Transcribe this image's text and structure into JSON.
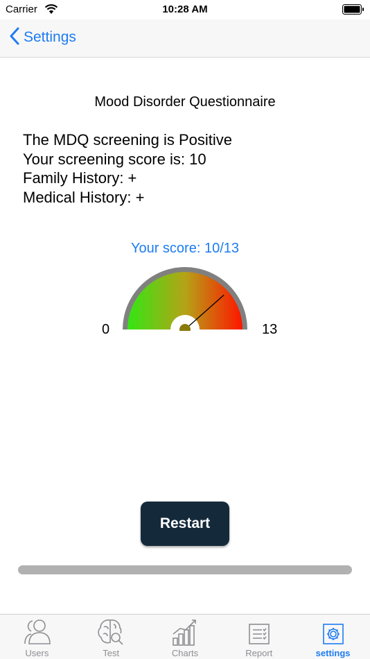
{
  "status_bar": {
    "carrier": "Carrier",
    "time": "10:28 AM"
  },
  "nav": {
    "back_label": "Settings"
  },
  "main": {
    "title": "Mood Disorder Questionnaire",
    "results": [
      "The MDQ screening is Positive",
      "Your screening score is: 10",
      "Family History: +",
      "Medical History: +"
    ],
    "score_label": "Your score: 10/13",
    "gauge": {
      "min_label": "0",
      "max_label": "13",
      "value": 10,
      "max": 13
    },
    "restart_label": "Restart"
  },
  "tabs": [
    {
      "label": "Users",
      "icon": "users-icon",
      "active": false
    },
    {
      "label": "Test",
      "icon": "brain-search-icon",
      "active": false
    },
    {
      "label": "Charts",
      "icon": "bar-chart-icon",
      "active": false
    },
    {
      "label": "Report",
      "icon": "report-icon",
      "active": false
    },
    {
      "label": "settings",
      "icon": "gear-icon",
      "active": true
    }
  ],
  "colors": {
    "accent": "#1d7cf2",
    "button_bg": "#142a3b",
    "gauge_start": "#33e614",
    "gauge_end": "#ff1500",
    "gauge_rim": "#808080"
  }
}
